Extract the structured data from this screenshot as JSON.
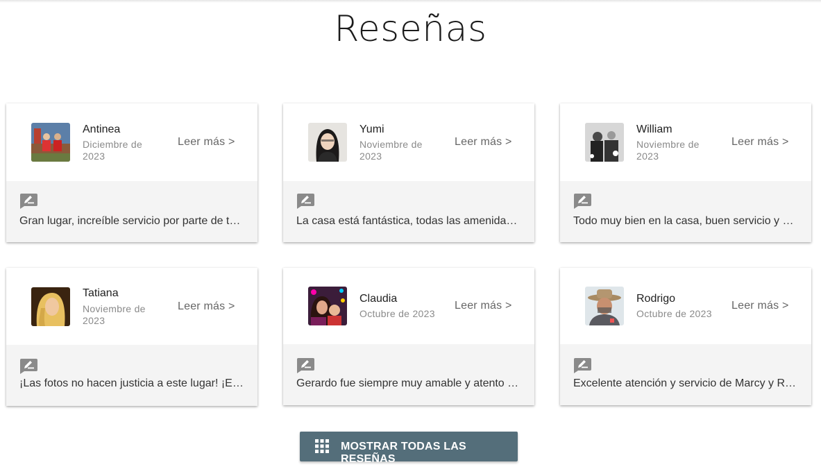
{
  "page": {
    "title": "Reseñas"
  },
  "reviews": [
    {
      "name": "Antinea",
      "date": "Diciembre de 2023",
      "read_more": "Leer más >",
      "text": "Gran lugar, increíble servicio por parte de todo el equipo",
      "avatar": "avatar-antinea"
    },
    {
      "name": "Yumi",
      "date": "Noviembre de 2023",
      "read_more": "Leer más >",
      "text": "La casa está fantástica, todas las amenidades",
      "avatar": "avatar-yumi"
    },
    {
      "name": "William",
      "date": "Noviembre de 2023",
      "read_more": "Leer más >",
      "text": "Todo muy bien en la casa, buen servicio y muy",
      "avatar": "avatar-william"
    },
    {
      "name": "Tatiana",
      "date": "Noviembre de 2023",
      "read_more": "Leer más >",
      "text": "¡Las fotos no hacen justicia a este lugar! ¡El lugar",
      "avatar": "avatar-tatiana"
    },
    {
      "name": "Claudia",
      "date": "Octubre de 2023",
      "read_more": "Leer más >",
      "text": "Gerardo fue siempre muy amable y atento a todo",
      "avatar": "avatar-claudia"
    },
    {
      "name": "Rodrigo",
      "date": "Octubre de 2023",
      "read_more": "Leer más >",
      "text": "Excelente atención y servicio de Marcy y Roberto",
      "avatar": "avatar-rodrigo"
    }
  ],
  "show_all": {
    "label": "MOSTRAR TODAS LAS RESEÑAS",
    "icon": "grid-icon",
    "color": "#546e7a"
  },
  "icons": {
    "review": "rate-review-icon"
  }
}
